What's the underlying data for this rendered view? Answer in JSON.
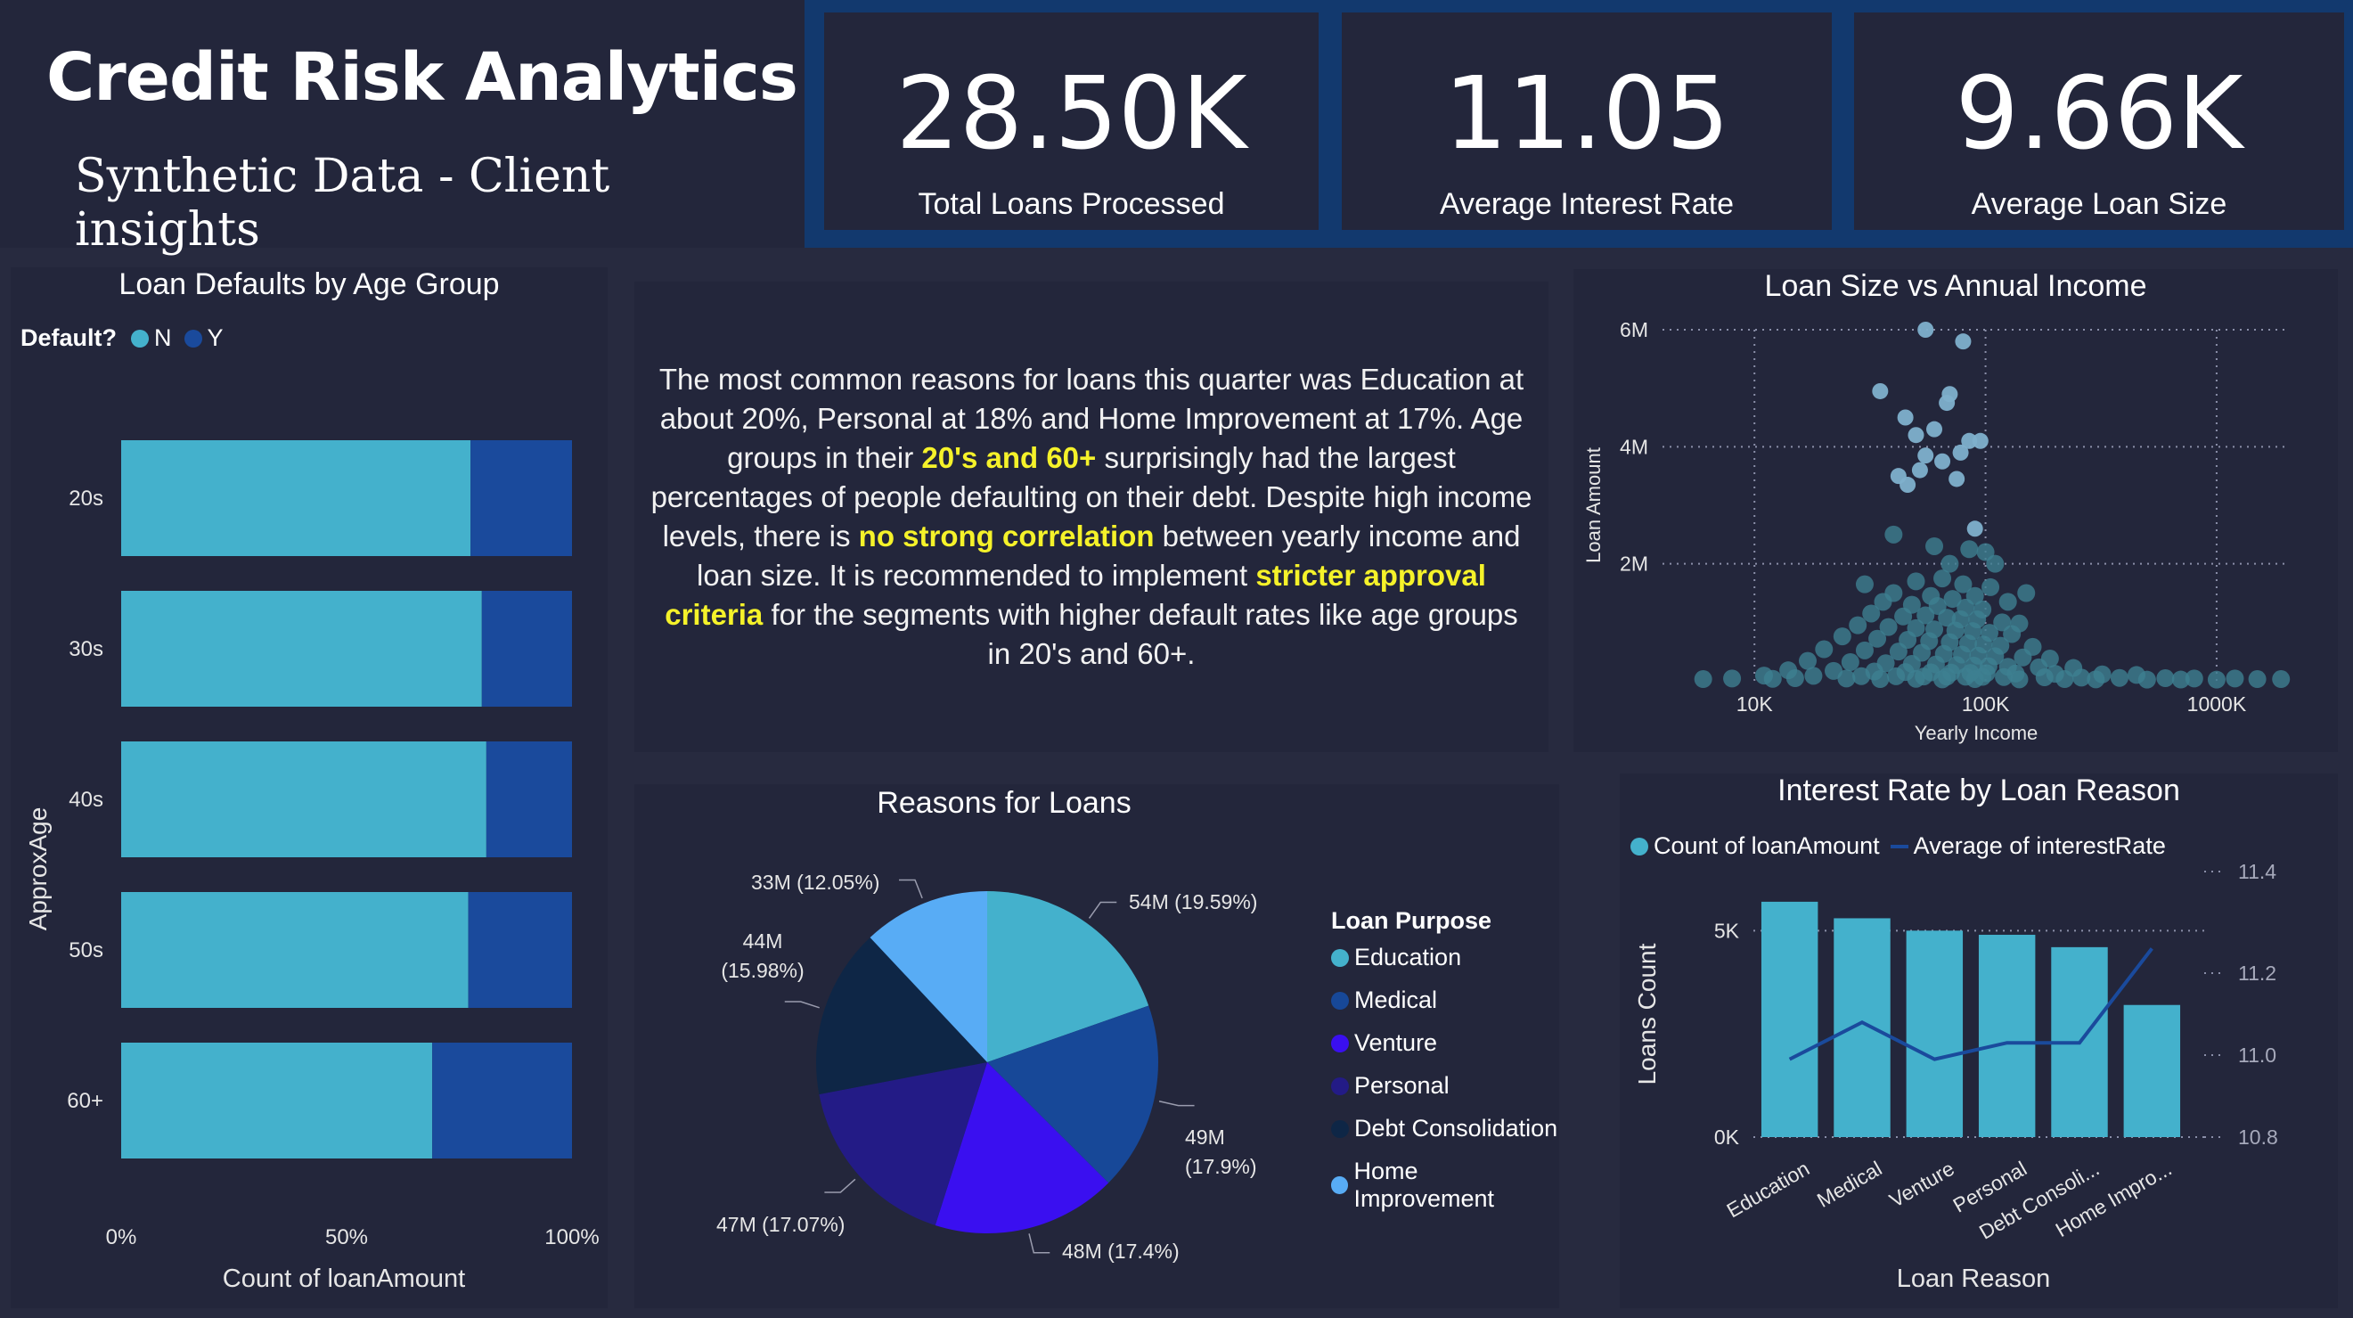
{
  "header": {
    "title": "Credit Risk Analytics",
    "subtitle": "Synthetic Data - Client insights"
  },
  "kpis": [
    {
      "value": "28.50K",
      "label": "Total Loans Processed"
    },
    {
      "value": "11.05",
      "label": "Average Interest Rate"
    },
    {
      "value": "9.66K",
      "label": "Average Loan Size"
    }
  ],
  "insight": {
    "p1": "The most common reasons for loans this quarter was Education at about 20%, Personal at 18% and Home Improvement at 17%. Age groups in their ",
    "h1": "20's and 60+",
    "p2": " surprisingly had the largest percentages of people defaulting on their debt. Despite high income levels, there is ",
    "h2": "no strong correlation",
    "p3": " between yearly income and loan size. It is recommended to implement ",
    "h3": "stricter approval criteria",
    "p4": " for the segments with higher default rates like age groups in 20's and 60+."
  },
  "colors": {
    "light_blue": "#44b1cc",
    "dark_blue": "#1a4a9c",
    "pie_medical": "#174898",
    "pie_venture": "#3a0ff0",
    "pie_personal": "#231b86",
    "pie_debt": "#0e2646",
    "pie_home": "#58acf5",
    "highlight": "#f5f22a"
  },
  "chart_data": [
    {
      "type": "bar",
      "stacked": "100%",
      "orientation": "horizontal",
      "title": "Loan Defaults by Age Group",
      "legend_title": "Default?",
      "categories": [
        "20s",
        "30s",
        "40s",
        "50s",
        "60+"
      ],
      "series": [
        {
          "name": "N",
          "values": [
            77.5,
            80,
            81,
            77,
            69
          ]
        },
        {
          "name": "Y",
          "values": [
            22.5,
            20,
            19,
            23,
            31
          ]
        }
      ],
      "xlabel": "Count of loanAmount",
      "ylabel": "ApproxAge",
      "xticks": [
        "0%",
        "50%",
        "100%"
      ],
      "xlim": [
        0,
        100
      ]
    },
    {
      "type": "scatter",
      "title": "Loan Size vs Annual Income",
      "xlabel": "Yearly Income",
      "ylabel": "Loan Amount",
      "xscale": "log",
      "xlim": [
        4000,
        2000000
      ],
      "ylim": [
        0,
        6000000
      ],
      "xticks": [
        "10K",
        "100K",
        "1000K"
      ],
      "yticks": [
        "2M",
        "4M",
        "6M"
      ],
      "points": [
        [
          55000,
          6000000
        ],
        [
          80000,
          5800000
        ],
        [
          35000,
          4950000
        ],
        [
          70000,
          4900000
        ],
        [
          68000,
          4750000
        ],
        [
          45000,
          4500000
        ],
        [
          60000,
          4300000
        ],
        [
          50000,
          4200000
        ],
        [
          85000,
          4100000
        ],
        [
          95000,
          4100000
        ],
        [
          78000,
          3900000
        ],
        [
          55000,
          3850000
        ],
        [
          65000,
          3750000
        ],
        [
          52000,
          3600000
        ],
        [
          75000,
          3450000
        ],
        [
          42000,
          3500000
        ],
        [
          46000,
          3350000
        ],
        [
          90000,
          2600000
        ],
        [
          40000,
          2500000
        ],
        [
          60000,
          2300000
        ],
        [
          85000,
          2250000
        ],
        [
          100000,
          2200000
        ],
        [
          110000,
          2000000
        ],
        [
          70000,
          2000000
        ],
        [
          30000,
          1650000
        ],
        [
          50000,
          1700000
        ],
        [
          65000,
          1750000
        ],
        [
          80000,
          1650000
        ],
        [
          105000,
          1600000
        ],
        [
          150000,
          1500000
        ],
        [
          40000,
          1500000
        ],
        [
          58000,
          1450000
        ],
        [
          72000,
          1400000
        ],
        [
          90000,
          1450000
        ],
        [
          125000,
          1350000
        ],
        [
          36000,
          1350000
        ],
        [
          48000,
          1300000
        ],
        [
          62000,
          1280000
        ],
        [
          82000,
          1250000
        ],
        [
          97000,
          1220000
        ],
        [
          32000,
          1150000
        ],
        [
          44000,
          1100000
        ],
        [
          55000,
          1120000
        ],
        [
          68000,
          1080000
        ],
        [
          78000,
          1050000
        ],
        [
          92000,
          1050000
        ],
        [
          118000,
          1000000
        ],
        [
          140000,
          980000
        ],
        [
          28000,
          950000
        ],
        [
          38000,
          920000
        ],
        [
          50000,
          900000
        ],
        [
          60000,
          880000
        ],
        [
          74000,
          860000
        ],
        [
          88000,
          850000
        ],
        [
          104000,
          820000
        ],
        [
          130000,
          800000
        ],
        [
          24000,
          760000
        ],
        [
          34000,
          720000
        ],
        [
          46000,
          700000
        ],
        [
          57000,
          680000
        ],
        [
          70000,
          660000
        ],
        [
          84000,
          640000
        ],
        [
          98000,
          620000
        ],
        [
          116000,
          600000
        ],
        [
          160000,
          580000
        ],
        [
          20000,
          540000
        ],
        [
          30000,
          520000
        ],
        [
          42000,
          500000
        ],
        [
          53000,
          480000
        ],
        [
          66000,
          460000
        ],
        [
          79000,
          450000
        ],
        [
          93000,
          430000
        ],
        [
          110000,
          420000
        ],
        [
          145000,
          400000
        ],
        [
          190000,
          380000
        ],
        [
          17000,
          340000
        ],
        [
          26000,
          320000
        ],
        [
          37000,
          300000
        ],
        [
          48000,
          290000
        ],
        [
          61000,
          280000
        ],
        [
          75000,
          270000
        ],
        [
          89000,
          260000
        ],
        [
          103000,
          250000
        ],
        [
          125000,
          240000
        ],
        [
          170000,
          230000
        ],
        [
          240000,
          220000
        ],
        [
          14000,
          180000
        ],
        [
          22000,
          170000
        ],
        [
          33000,
          160000
        ],
        [
          45000,
          150000
        ],
        [
          58000,
          145000
        ],
        [
          71000,
          140000
        ],
        [
          86000,
          135000
        ],
        [
          101000,
          130000
        ],
        [
          135000,
          125000
        ],
        [
          200000,
          120000
        ],
        [
          320000,
          110000
        ],
        [
          450000,
          100000
        ],
        [
          11000,
          90000
        ],
        [
          18000,
          85000
        ],
        [
          29000,
          80000
        ],
        [
          41000,
          78000
        ],
        [
          54000,
          75000
        ],
        [
          68000,
          72000
        ],
        [
          82000,
          70000
        ],
        [
          97000,
          68000
        ],
        [
          120000,
          65000
        ],
        [
          180000,
          60000
        ],
        [
          260000,
          55000
        ],
        [
          380000,
          50000
        ],
        [
          600000,
          45000
        ],
        [
          800000,
          40000
        ],
        [
          1200000,
          40000
        ],
        [
          1500000,
          30000
        ],
        [
          1900000,
          30000
        ],
        [
          8000,
          40000
        ],
        [
          6000,
          30000
        ],
        [
          12000,
          35000
        ],
        [
          15000,
          45000
        ],
        [
          25000,
          40000
        ],
        [
          35000,
          30000
        ],
        [
          50000,
          35000
        ],
        [
          65000,
          25000
        ],
        [
          90000,
          30000
        ],
        [
          140000,
          25000
        ],
        [
          220000,
          30000
        ],
        [
          300000,
          25000
        ],
        [
          500000,
          20000
        ],
        [
          700000,
          22000
        ],
        [
          1000000,
          20000
        ]
      ]
    },
    {
      "type": "pie",
      "title": "Reasons for Loans",
      "legend_title": "Loan Purpose",
      "slices": [
        {
          "name": "Education",
          "value": 54,
          "label": "54M (19.59%)",
          "percent": 19.59
        },
        {
          "name": "Medical",
          "value": 49,
          "label": "49M (17.9%)",
          "percent": 17.9
        },
        {
          "name": "Venture",
          "value": 48,
          "label": "48M (17.4%)",
          "percent": 17.4
        },
        {
          "name": "Personal",
          "value": 47,
          "label": "47M (17.07%)",
          "percent": 17.07
        },
        {
          "name": "Debt Consolidation",
          "value": 44,
          "label": "44M (15.98%)",
          "percent": 15.98
        },
        {
          "name": "Home Improvement",
          "value": 33,
          "label": "33M (12.05%)",
          "percent": 12.05
        }
      ]
    },
    {
      "type": "bar",
      "combo": "bar-line",
      "title": "Interest Rate by Loan Reason",
      "categories": [
        "Education",
        "Medical",
        "Venture",
        "Personal",
        "Debt Consoli...",
        "Home Impro..."
      ],
      "series": [
        {
          "name": "Count of loanAmount",
          "kind": "bar",
          "axis": "left",
          "values": [
            5700,
            5300,
            5000,
            4900,
            4600,
            3200
          ]
        },
        {
          "name": "Average of interestRate",
          "kind": "line",
          "axis": "right",
          "values": [
            10.99,
            11.08,
            10.99,
            11.03,
            11.03,
            11.26
          ]
        }
      ],
      "xlabel": "Loan Reason",
      "ylabel": "Loans Count",
      "ylim": [
        0,
        6000
      ],
      "yticks": [
        "0K",
        "5K"
      ],
      "y2lim": [
        10.8,
        11.4
      ],
      "y2ticks": [
        "10.8",
        "11.0",
        "11.2",
        "11.4"
      ]
    }
  ]
}
